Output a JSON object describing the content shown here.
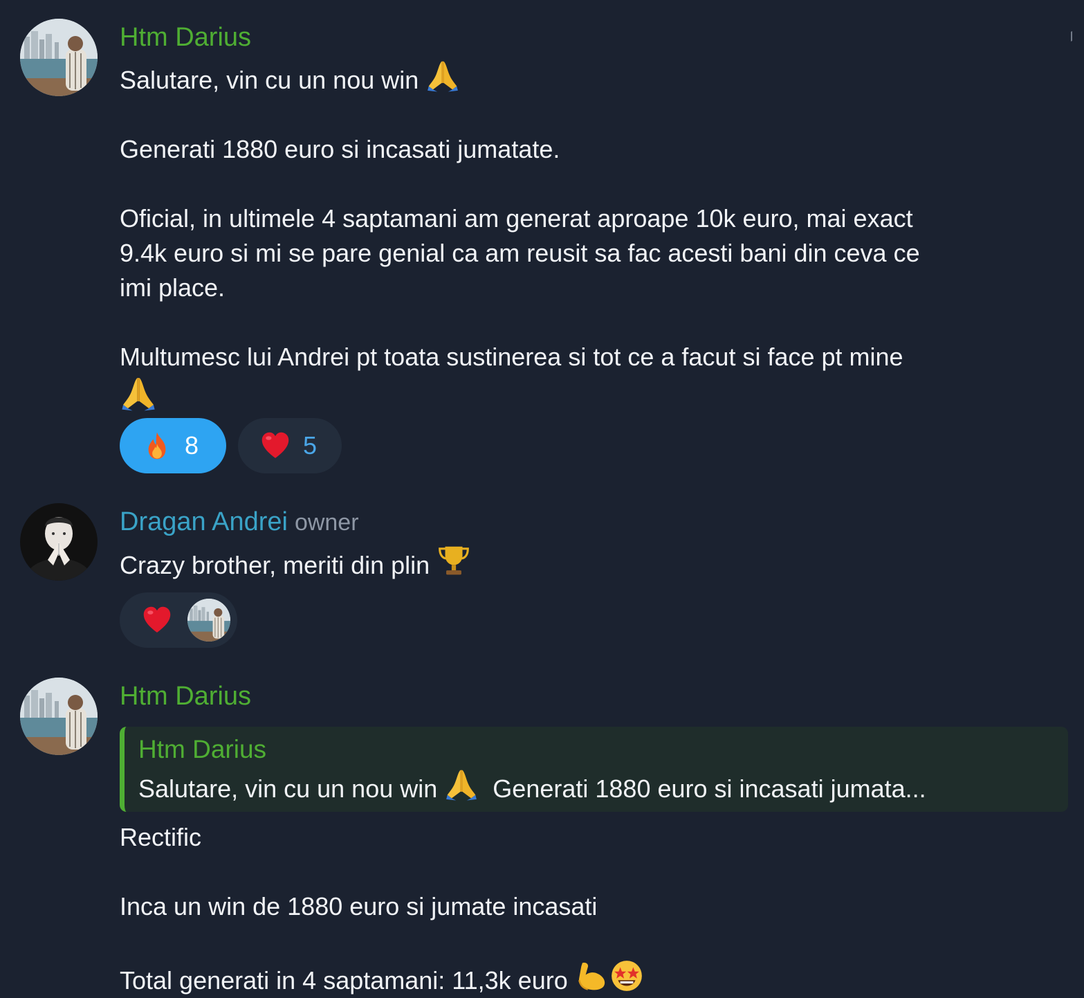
{
  "messages": [
    {
      "sender": "Htm Darius",
      "avatar_icon": "person-on-balcony-avatar",
      "lines": [
        "Salutare, vin cu un nou win",
        "Generati 1880 euro si incasati jumatate.",
        "Oficial, in ultimele 4 saptamani am generat aproape 10k euro, mai exact",
        "9.4k euro si mi se pare genial ca am reusit sa fac acesti bani din ceva ce",
        "imi place.",
        "Multumesc lui Andrei pt toata sustinerea si tot ce a facut si face pt mine"
      ],
      "reactions": [
        {
          "icon": "fire-icon",
          "count": "8",
          "active": true
        },
        {
          "icon": "heart-icon",
          "count": "5",
          "active": false
        }
      ]
    },
    {
      "sender": "Dragan Andrei",
      "role": "owner",
      "avatar_icon": "man-hands-clasped-avatar",
      "text": "Crazy brother, meriti din plin",
      "reactions": [
        {
          "icon": "heart-icon",
          "reactor_avatar": "person-on-balcony-avatar"
        }
      ]
    },
    {
      "sender": "Htm Darius",
      "avatar_icon": "person-on-balcony-avatar",
      "reply": {
        "sender": "Htm Darius",
        "text_a": "Salutare, vin cu un nou win",
        "text_b": "Generati 1880 euro si incasati jumata..."
      },
      "lines": [
        "Rectific",
        "Inca un win de 1880 euro si jumate incasati",
        "Total generati in 4 saptamani: 11,3k euro"
      ]
    }
  ],
  "colors": {
    "background": "#1b2230",
    "name_green": "#4fae33",
    "name_blue": "#3aa3c7",
    "reaction_active": "#2ea4f2",
    "reaction_inactive": "#232d3c"
  }
}
